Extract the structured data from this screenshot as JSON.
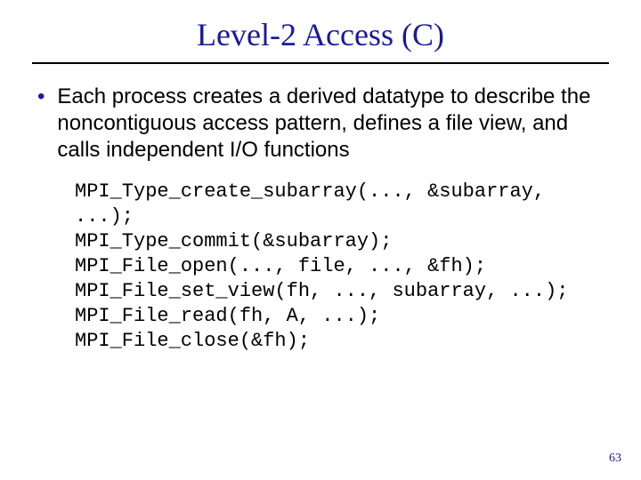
{
  "title": "Level-2 Access (C)",
  "bullet": "Each process creates a derived datatype to describe the noncontiguous access pattern, defines a file view, and calls independent I/O functions",
  "code": {
    "l1": "MPI_Type_create_subarray(..., &subarray,",
    "l2": "...);",
    "l3": "MPI_Type_commit(&subarray);",
    "l4": "MPI_File_open(..., file, ..., &fh);",
    "l5": "MPI_File_set_view(fh, ..., subarray, ...);",
    "l6": "MPI_File_read(fh, A, ...);",
    "l7": "MPI_File_close(&fh);"
  },
  "page_number": "63"
}
